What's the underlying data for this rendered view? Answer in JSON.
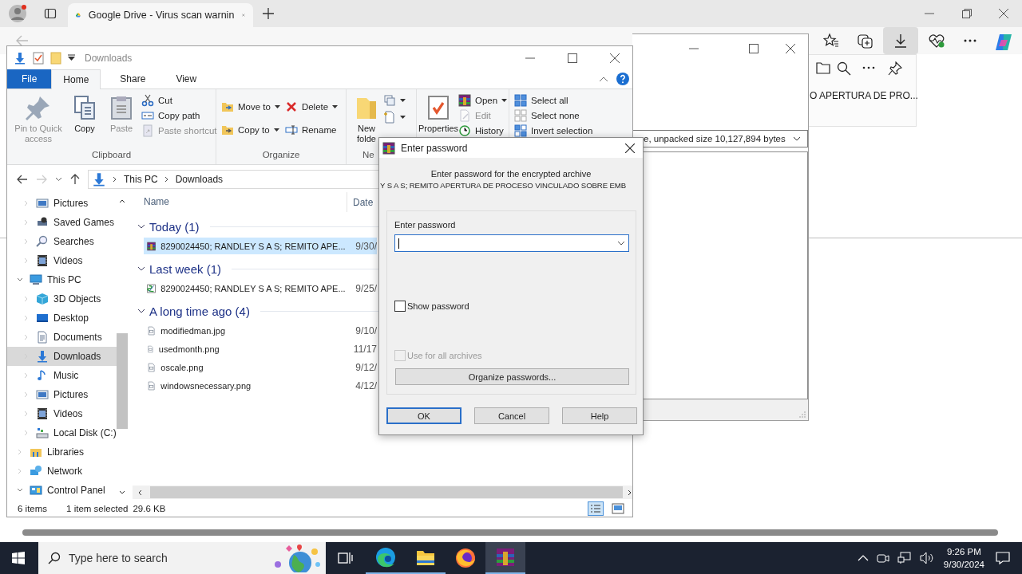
{
  "browser": {
    "tab": {
      "title": "Google Drive - Virus scan warnin",
      "selected": true
    },
    "downloads_panel": {
      "item_text": "O APERTURA DE PRO..."
    }
  },
  "archiver_window": {
    "info_combo": "e, unpacked size 10,127,894 bytes"
  },
  "explorer": {
    "title": "Downloads",
    "tabs": [
      {
        "label": "File",
        "kind": "file",
        "selected": false
      },
      {
        "label": "Home",
        "kind": "tab",
        "selected": true
      },
      {
        "label": "Share",
        "kind": "tab",
        "selected": false
      },
      {
        "label": "View",
        "kind": "tab",
        "selected": false
      }
    ],
    "ribbon": [
      {
        "label": "Clipboard",
        "columns": [
          [
            {
              "label": "Pin to Quick access",
              "kind": "large",
              "disabled": true
            }
          ],
          [
            {
              "label": "Copy",
              "kind": "large",
              "disabled": false
            }
          ],
          [
            {
              "label": "Paste",
              "kind": "large",
              "disabled": true
            }
          ],
          [
            {
              "label": "Cut",
              "kind": "small",
              "disabled": false
            },
            {
              "label": "Copy path",
              "kind": "small",
              "disabled": false
            },
            {
              "label": "Paste shortcut",
              "kind": "small",
              "disabled": true
            }
          ]
        ]
      },
      {
        "label": "Organize",
        "columns": [
          [
            {
              "label": "Move to",
              "kind": "small",
              "menu": true,
              "disabled": false
            },
            {
              "label": "Copy to",
              "kind": "small",
              "menu": true,
              "disabled": false
            }
          ],
          [
            {
              "label": "Delete",
              "kind": "small",
              "menu": true,
              "disabled": false
            },
            {
              "label": "Rename",
              "kind": "small",
              "disabled": false
            }
          ]
        ]
      },
      {
        "label": "Ne",
        "columns": [
          [
            {
              "label": "New folde",
              "kind": "large",
              "disabled": false
            }
          ],
          [
            {
              "kind": "small",
              "menu": true,
              "disabled": false
            },
            {
              "kind": "small",
              "menu": true,
              "disabled": false
            }
          ]
        ]
      },
      {
        "columns": [
          [
            {
              "label": "Properties",
              "kind": "large",
              "disabled": false
            }
          ],
          [
            {
              "label": "Open",
              "kind": "small",
              "menu": true,
              "disabled": false
            },
            {
              "label": "Edit",
              "kind": "small",
              "disabled": true
            },
            {
              "label": "History",
              "kind": "small",
              "disabled": false
            }
          ]
        ]
      },
      {
        "columns": [
          [
            {
              "label": "Select all",
              "kind": "small",
              "disabled": false
            },
            {
              "label": "Select none",
              "kind": "small",
              "disabled": false
            },
            {
              "label": "Invert selection",
              "kind": "small",
              "disabled": false
            }
          ]
        ]
      }
    ],
    "address": [
      "This PC",
      "Downloads"
    ],
    "nav": [
      {
        "children": [
          {
            "label": "Pictures",
            "expanded": false,
            "selected": false
          },
          {
            "label": "Saved Games",
            "expanded": false,
            "selected": false
          },
          {
            "label": "Searches",
            "expanded": false,
            "selected": false
          },
          {
            "label": "Videos",
            "expanded": false,
            "selected": false
          }
        ]
      },
      {
        "label": "This PC",
        "expanded": true,
        "selected": false,
        "children": [
          {
            "label": "3D Objects",
            "expanded": false,
            "selected": false
          },
          {
            "label": "Desktop",
            "expanded": false,
            "selected": false
          },
          {
            "label": "Documents",
            "expanded": false,
            "selected": false
          },
          {
            "label": "Downloads",
            "expanded": false,
            "selected": true
          },
          {
            "label": "Music",
            "expanded": false,
            "selected": false
          },
          {
            "label": "Pictures",
            "expanded": false,
            "selected": false
          },
          {
            "label": "Videos",
            "expanded": false,
            "selected": false
          },
          {
            "label": "Local Disk (C:)",
            "expanded": false,
            "selected": false
          }
        ]
      },
      {
        "label": "Libraries",
        "expanded": false,
        "selected": false
      },
      {
        "label": "Network",
        "expanded": false,
        "selected": false
      },
      {
        "label": "Control Panel",
        "expanded": true,
        "selected": false
      }
    ],
    "columns": [
      "Name",
      "Date"
    ],
    "groups": [
      {
        "label": "Today (1)",
        "expanded": true,
        "files": [
          {
            "name": "8290024450; RANDLEY S A S; REMITO APE...",
            "date": "9/30/",
            "kind": "rar",
            "selected": true
          }
        ]
      },
      {
        "label": "Last week (1)",
        "expanded": true,
        "files": [
          {
            "name": "8290024450; RANDLEY S A S; REMITO APE...",
            "date": "9/25/",
            "kind": "sfx",
            "selected": false
          }
        ]
      },
      {
        "label": "A long time ago (4)",
        "expanded": true,
        "files": [
          {
            "name": "modifiedman.jpg",
            "date": "9/10/",
            "kind": "image",
            "selected": false
          },
          {
            "name": "usedmonth.png",
            "date": "11/17",
            "kind": "image",
            "selected": false
          },
          {
            "name": "oscale.png",
            "date": "9/12/",
            "kind": "image",
            "selected": false
          },
          {
            "name": "windowsnecessary.png",
            "date": "4/12/",
            "kind": "image",
            "selected": false
          }
        ]
      }
    ],
    "status": {
      "item_count": "6 items",
      "selection": "1 item selected",
      "size": "29.6 KB"
    }
  },
  "password_dialog": {
    "title": "Enter password",
    "message": "Enter password for the encrypted archive",
    "archive_name": "Y S A S; REMITO APERTURA DE PROCESO VINCULADO SOBRE EMB",
    "field": {
      "label": "Enter password",
      "focused": true
    },
    "checkboxes": [
      {
        "label": "Show password",
        "checked": false,
        "disabled": false
      },
      {
        "label": "Use for all archives",
        "checked": false,
        "disabled": true
      }
    ],
    "organize_button": "Organize passwords...",
    "buttons": [
      {
        "label": "OK",
        "default": true
      },
      {
        "label": "Cancel",
        "default": false
      },
      {
        "label": "Help",
        "default": false
      }
    ]
  },
  "taskbar": {
    "search_placeholder": "Type here to search",
    "apps": [
      {
        "kind": "taskview",
        "running": false,
        "selected": false
      },
      {
        "kind": "edge",
        "running": true,
        "selected": false
      },
      {
        "kind": "explorer",
        "running": true,
        "selected": false
      },
      {
        "kind": "firefox",
        "running": false,
        "selected": false
      },
      {
        "kind": "winrar",
        "running": true,
        "selected": true
      }
    ],
    "time": "9:26 PM",
    "date": "9/30/2024"
  }
}
